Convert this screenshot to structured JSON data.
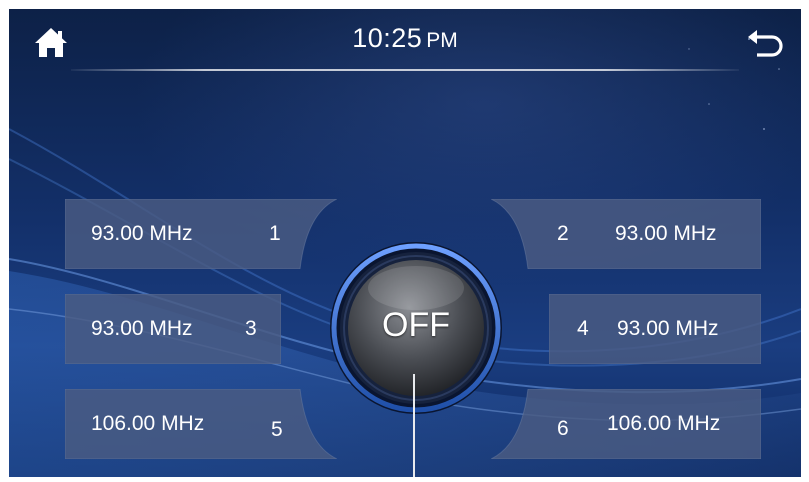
{
  "header": {
    "time": "10:25",
    "ampm": "PM",
    "home_icon": "home-icon",
    "back_icon": "back-arrow-icon"
  },
  "presets": [
    {
      "number": "1",
      "frequency": "93.00  MHz"
    },
    {
      "number": "2",
      "frequency": "93.00  MHz"
    },
    {
      "number": "3",
      "frequency": "93.00  MHz"
    },
    {
      "number": "4",
      "frequency": "93.00  MHz"
    },
    {
      "number": "5",
      "frequency": "106.00  MHz"
    },
    {
      "number": "6",
      "frequency": "106.00  MHz"
    }
  ],
  "power_button": {
    "label": "OFF"
  },
  "colors": {
    "background": "#13306a",
    "preset_fill": "#4a5c82",
    "text": "#ffffff",
    "button_ring": "#3d6fc4"
  }
}
